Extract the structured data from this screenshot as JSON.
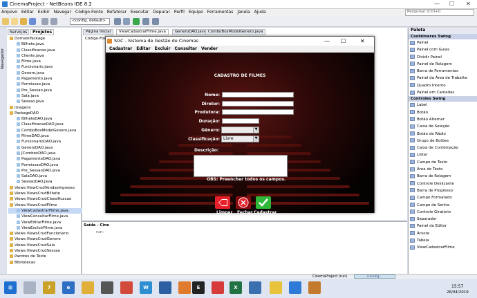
{
  "window": {
    "title": "CinemaProject - NetBeans IDE 8.2",
    "controls": [
      "—",
      "☐",
      "✕"
    ]
  },
  "menu": [
    "Arquivo",
    "Editar",
    "Exibir",
    "Navegar",
    "Código-Fonte",
    "Refatorar",
    "Executar",
    "Depurar",
    "Perfil",
    "Equipe",
    "Ferramentas",
    "Janela",
    "Ajuda"
  ],
  "search": {
    "placeholder": "Pesquisar (Ctrl+I)"
  },
  "toolbar": {
    "config": "<config. default>"
  },
  "projects": {
    "tabs": [
      "Serviços",
      "Projetos"
    ],
    "navigator": "Navegador",
    "tree": [
      {
        "label": "DomainPackage",
        "type": "pkg"
      },
      {
        "label": "Bilhete.java",
        "type": "file"
      },
      {
        "label": "Classificacao.java",
        "type": "file"
      },
      {
        "label": "Cliente.java",
        "type": "file"
      },
      {
        "label": "Filme.java",
        "type": "file"
      },
      {
        "label": "Funcionario.java",
        "type": "file"
      },
      {
        "label": "Genero.java",
        "type": "file"
      },
      {
        "label": "Pagamento.java",
        "type": "file"
      },
      {
        "label": "Permissao.java",
        "type": "file"
      },
      {
        "label": "Pre_Sessao.java",
        "type": "file"
      },
      {
        "label": "Sala.java",
        "type": "file"
      },
      {
        "label": "Sessao.java",
        "type": "file"
      },
      {
        "label": "Imagens",
        "type": "pkg"
      },
      {
        "label": "PackageDAO",
        "type": "pkg"
      },
      {
        "label": "BilheteDAO.java",
        "type": "file"
      },
      {
        "label": "ClassificacaoDAO.java",
        "type": "file"
      },
      {
        "label": "ComboBoxModelGenero.java",
        "type": "file"
      },
      {
        "label": "FilmeDAO.java",
        "type": "file"
      },
      {
        "label": "FuncionarioDAO.java",
        "type": "file"
      },
      {
        "label": "GeneroDAO.java",
        "type": "file"
      },
      {
        "label": "JComboxDAO.java",
        "type": "file"
      },
      {
        "label": "PagamentoDAO.java",
        "type": "file"
      },
      {
        "label": "PermissaoDAO.java",
        "type": "file"
      },
      {
        "label": "Pre_SessaoDAO.java",
        "type": "file"
      },
      {
        "label": "SalaDAO.java",
        "type": "file"
      },
      {
        "label": "SessaoDAO.java",
        "type": "file"
      },
      {
        "label": "Views.ViewCrudVendasIngresso",
        "type": "pkg"
      },
      {
        "label": "Views.ViewsCrudBilhete",
        "type": "pkg"
      },
      {
        "label": "Views.ViewsCrudClassificacao",
        "type": "pkg"
      },
      {
        "label": "Views.ViewsCrudFilme",
        "type": "pkg"
      },
      {
        "label": "ViewCadastrarFilme.java",
        "type": "file",
        "selected": true
      },
      {
        "label": "ViewConsultarFilme.java",
        "type": "file"
      },
      {
        "label": "ViewEditarFilme.java",
        "type": "file"
      },
      {
        "label": "ViewExcluirFilme.java",
        "type": "file"
      },
      {
        "label": "Views.ViewsCrudFuncionario",
        "type": "pkg"
      },
      {
        "label": "Views.ViewsCrudGenero",
        "type": "pkg"
      },
      {
        "label": "Views.ViewsCrudSala",
        "type": "pkg"
      },
      {
        "label": "Views.ViewsCrudSessao",
        "type": "pkg"
      },
      {
        "label": "Pacotes de Teste",
        "type": "pkg"
      },
      {
        "label": "Bibliotecas",
        "type": "pkg"
      }
    ]
  },
  "editor": {
    "tabs": [
      "Página Inicial",
      "ViewCadastrarFilme.java",
      "GeneroDAO.java",
      "ComboBoxModelGenero.java"
    ],
    "subtab": "Código-Fonte"
  },
  "output": {
    "tab": "Saída - Cine",
    "line": "run:"
  },
  "palette": {
    "title": "Paleta",
    "groups": [
      {
        "name": "Contêineres Swing",
        "items": [
          "Painel",
          "Painel com Guias",
          "Dividir Painel",
          "Painel de Rolagem",
          "Barra de Ferramentas",
          "Painel da Área de Trabalho",
          "Quadro Interno",
          "Painel em Camadas"
        ]
      },
      {
        "name": "Controles Swing",
        "items": [
          "Label",
          "Botão",
          "Botão Alternar",
          "Caixa de Seleção",
          "Botão de Rádio",
          "Grupo de Botões",
          "Caixa de Combinação",
          "Listar",
          "Campo de Texto",
          "Área de Texto",
          "Barra de Rolagem",
          "Controle Deslizante",
          "Barra de Progresso",
          "Campo Formatado",
          "Campo de Senha",
          "Controle Giratório",
          "Separador",
          "Painel do Editor",
          "Árvore",
          "Tabela",
          "ViewCadastrarFilme"
        ]
      }
    ]
  },
  "status": {
    "project": "CinemaProject (run)",
    "running": "running..."
  },
  "taskbar": {
    "time": "15:57",
    "date": "26/04/2019"
  },
  "dialog": {
    "title": "SGC - Sistema de Gestão de Cinemas",
    "menu": [
      "Cadastrar",
      "Editar",
      "Excluir",
      "Consultar",
      "Vender"
    ],
    "heading": "CADASTRO DE FILMES",
    "fields": {
      "nome": "Nome:",
      "diretor": "Diretor:",
      "produtora": "Produtora:",
      "duracao": "Duração:",
      "genero": "Gênero:",
      "classificacao": "Classificação:",
      "descricao": "Descrição:"
    },
    "classificacao_value": "Livre",
    "obs": "OBS: Preencher todos os campos.",
    "buttons": {
      "limpar": "Limpar",
      "fechar": "Fechar",
      "cadastrar": "Cadastrar"
    }
  }
}
